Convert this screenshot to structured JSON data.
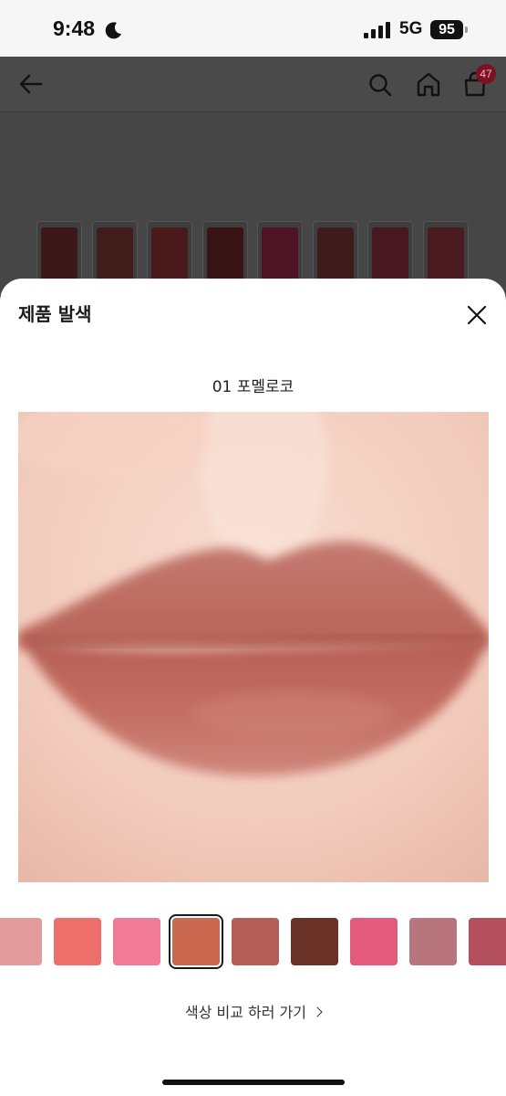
{
  "status_bar": {
    "time": "9:48",
    "network": "5G",
    "battery": "95",
    "icons": [
      "moon-icon",
      "signal-icon",
      "battery-icon"
    ]
  },
  "header": {
    "icons": [
      "back-arrow-icon",
      "search-icon",
      "home-icon",
      "cart-icon"
    ],
    "cart_count": "47"
  },
  "sheet": {
    "title": "제품 발색",
    "close_icon": "close-icon",
    "swatch_name": "01 포멜로코",
    "compare_link": "색상 비교 하러 가기",
    "compare_link_icon": "chevron-right-icon"
  },
  "swatches": {
    "selected_index": 3,
    "colors": [
      "#e39a9a",
      "#ee6e6c",
      "#f17b96",
      "#c9674f",
      "#b55e58",
      "#6b3327",
      "#e45a7c",
      "#b8757e",
      "#b34f5e"
    ]
  },
  "background_tubes": {
    "colors": [
      "#3c1818",
      "#401c1a",
      "#4a1a1b",
      "#381414",
      "#4e1424",
      "#3e1c1c",
      "#481820",
      "#4a1c20"
    ]
  }
}
